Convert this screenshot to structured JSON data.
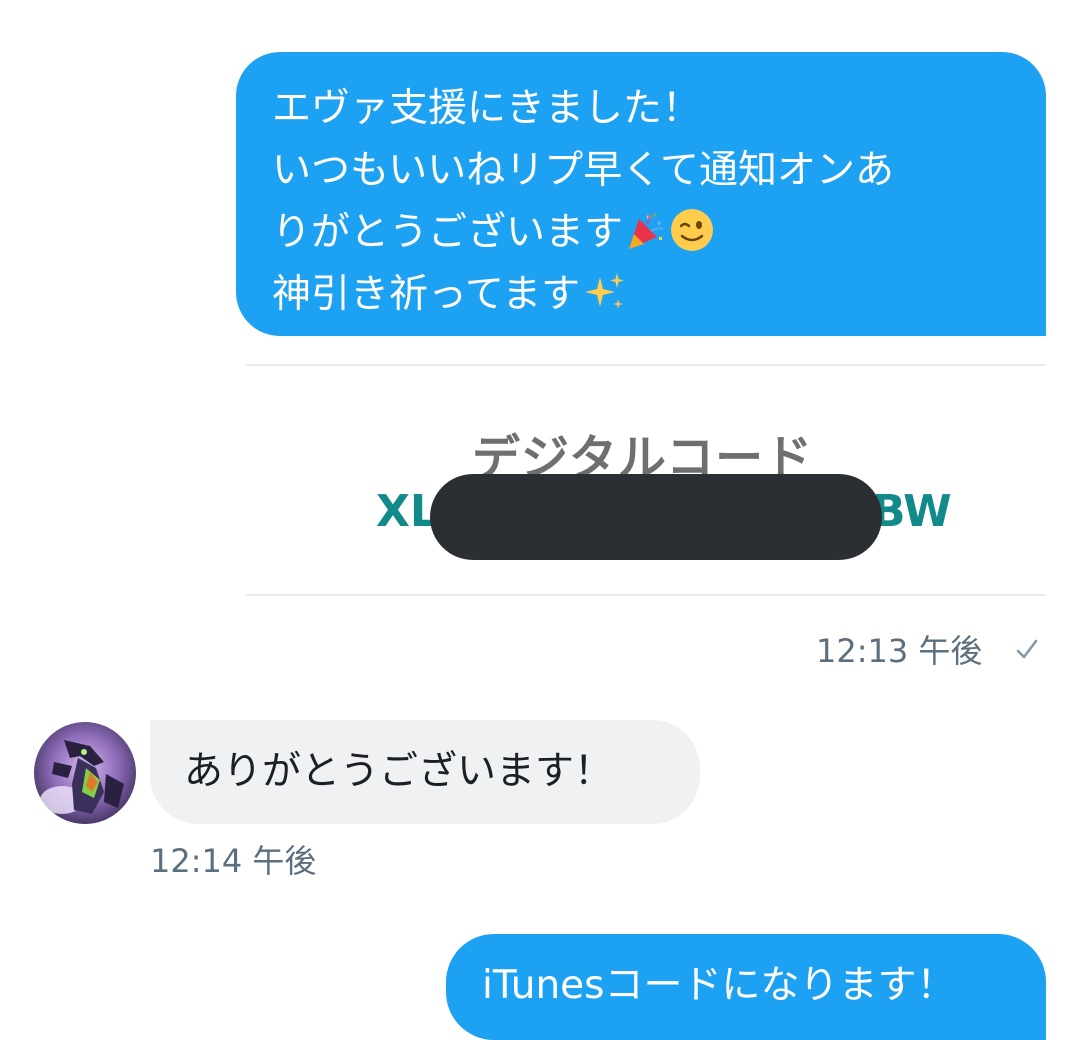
{
  "messages": {
    "outgoing_1": {
      "lines": [
        "エヴァ支援にきました！",
        "いつもいいねリプ早くて通知オンあ",
        "りがとうございます",
        "神引き祈ってます"
      ],
      "emoji": [
        "party-popper",
        "winking-face",
        "sparkles"
      ],
      "time": "12:13 午後",
      "status_icon": "check-icon"
    },
    "attachment": {
      "title": "デジタルコード",
      "code_prefix": "XL",
      "code_suffix": "BW",
      "redacted": true
    },
    "incoming_1": {
      "text": "ありがとうございます！",
      "time": "12:14 午後",
      "avatar": "user-avatar"
    },
    "outgoing_2": {
      "text": "iTunesコードになります！"
    }
  },
  "colors": {
    "outgoing_bubble": "#1da1f2",
    "incoming_bubble": "#eff1f3",
    "timestamp": "#5b6f7f",
    "code_text": "#138a8a",
    "redaction": "#2b2f33"
  }
}
